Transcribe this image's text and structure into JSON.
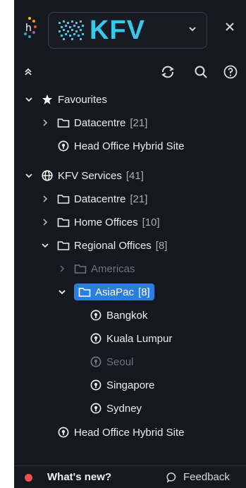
{
  "header": {
    "org_name": "KFV",
    "close_label": "✕"
  },
  "tree": {
    "favourites": {
      "label": "Favourites"
    },
    "fav_datacentre": {
      "label": "Datacentre",
      "count": "[21]"
    },
    "fav_head_office": {
      "label": "Head Office Hybrid Site"
    },
    "kfv_services": {
      "label": "KFV Services",
      "count": "[41]"
    },
    "svc_datacentre": {
      "label": "Datacentre",
      "count": "[21]"
    },
    "home_offices": {
      "label": "Home Offices",
      "count": "[10]"
    },
    "regional_offices": {
      "label": "Regional Offices",
      "count": "[8]"
    },
    "americas": {
      "label": "Americas"
    },
    "asiapac": {
      "label": "AsiaPac",
      "count": "[8]"
    },
    "sites": [
      {
        "label": "Bangkok"
      },
      {
        "label": "Kuala Lumpur"
      },
      {
        "label": "Seoul"
      },
      {
        "label": "Singapore"
      },
      {
        "label": "Sydney"
      }
    ],
    "head_office": {
      "label": "Head Office Hybrid Site"
    }
  },
  "footer": {
    "whats_new": "What's new?",
    "feedback": "Feedback"
  },
  "colors": {
    "panel_bg": "#15181e",
    "accent": "#37c8ee",
    "selected": "#2a7de1",
    "notification_dot": "#ef5151"
  }
}
